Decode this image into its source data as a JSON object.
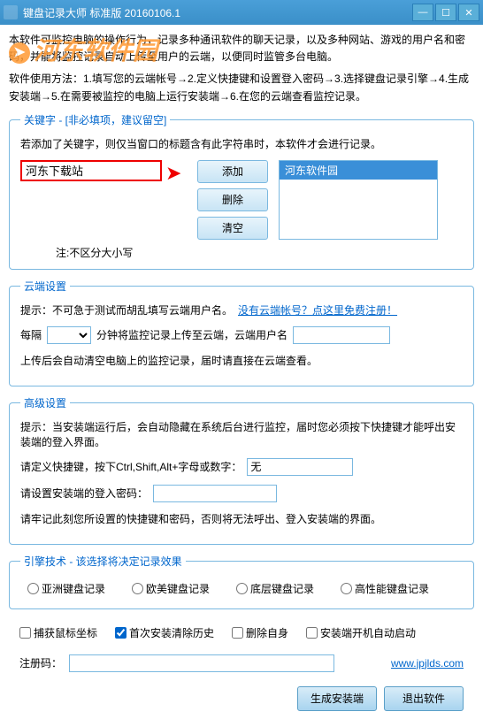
{
  "titlebar": {
    "title": "键盘记录大师 标准版 20160106.1"
  },
  "watermark": "河东软件园",
  "intro": "本软件可监控电脑的操作行为，记录多种通讯软件的聊天记录，以及多种网站、游戏的用户名和密码，并能将监控记录自动上传至用户的云端，以便同时监管多台电脑。",
  "usage": "软件使用方法：1.填写您的云端帐号→2.定义快捷键和设置登入密码→3.选择键盘记录引擎→4.生成安装端→5.在需要被监控的电脑上运行安装端→6.在您的云端查看监控记录。",
  "keywords": {
    "legend": "关键字 - [非必填项，建议留空]",
    "desc": "若添加了关键字，则仅当窗口的标题含有此字符串时，本软件才会进行记录。",
    "input_value": "河东下载站",
    "add": "添加",
    "del": "删除",
    "clear": "清空",
    "item0": "河东软件园",
    "note": "注:不区分大小写"
  },
  "cloud": {
    "legend": "云端设置",
    "tip_label": "提示：不可急于测试而胡乱填写云端用户名。",
    "reg_link": "没有云端帐号？点这里免费注册！",
    "interval_pre": "每隔",
    "interval_post": "分钟将监控记录上传至云端，云端用户名",
    "note": "上传后会自动清空电脑上的监控记录，届时请直接在云端查看。"
  },
  "adv": {
    "legend": "高级设置",
    "tip": "提示：当安装端运行后，会自动隐藏在系统后台进行监控，届时您必须按下快捷键才能呼出安装端的登入界面。",
    "hotkey_label": "请定义快捷键，按下Ctrl,Shift,Alt+字母或数字：",
    "hotkey_value": "无",
    "pwd_label": "请设置安装端的登入密码：",
    "remember": "请牢记此刻您所设置的快捷键和密码，否则将无法呼出、登入安装端的界面。"
  },
  "engine": {
    "legend": "引擎技术 - 该选择将决定记录效果",
    "r1": "亚洲键盘记录",
    "r2": "欧美键盘记录",
    "r3": "底层键盘记录",
    "r4": "高性能键盘记录"
  },
  "checks": {
    "c1": "捕获鼠标坐标",
    "c2": "首次安装清除历史",
    "c3": "删除自身",
    "c4": "安装端开机自动启动"
  },
  "reg": {
    "label": "注册码：",
    "link": "www.jpjlds.com"
  },
  "buttons": {
    "gen": "生成安装端",
    "exit": "退出软件"
  }
}
